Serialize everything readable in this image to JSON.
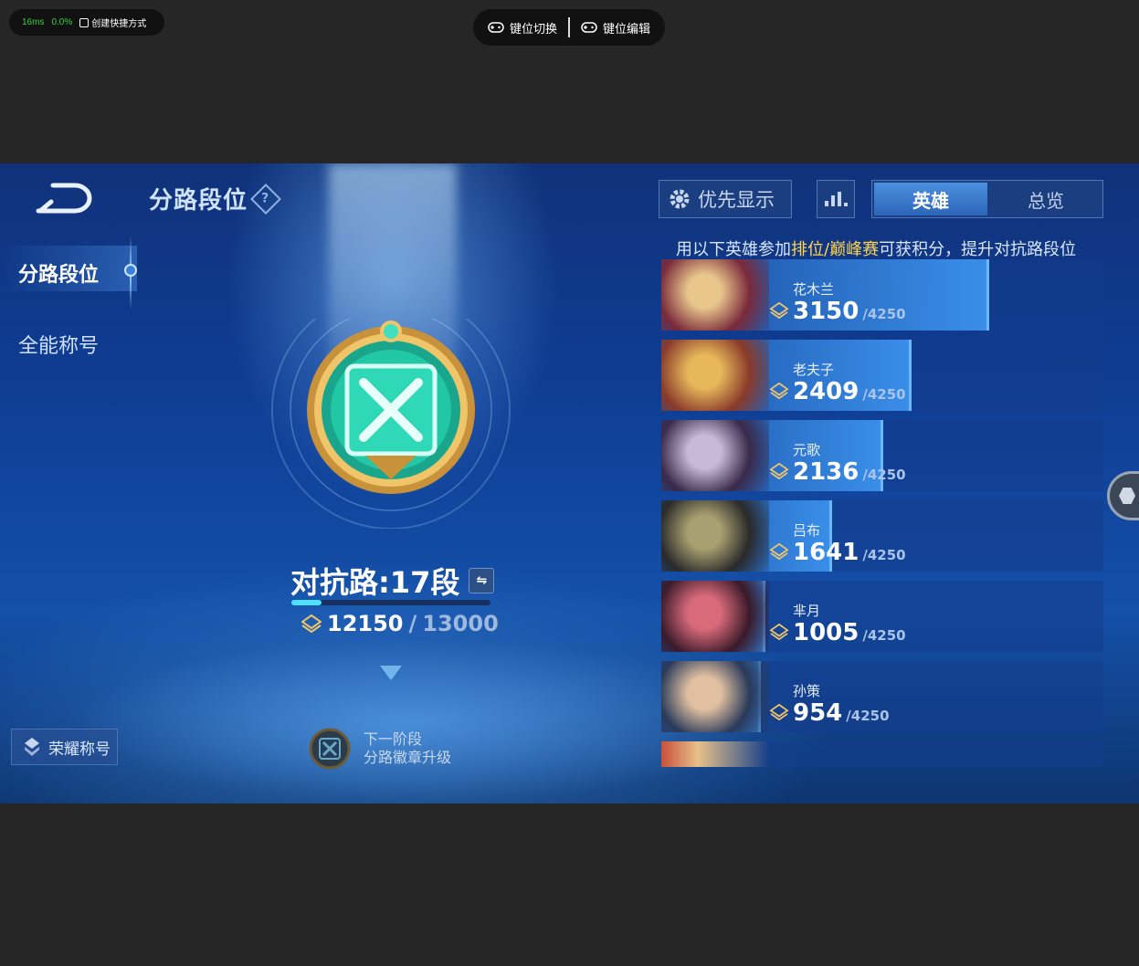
{
  "overlay": {
    "latency": "16ms",
    "loss": "0.0%",
    "shortcut_label": "创建快捷方式",
    "key_switch_label": "键位切换",
    "key_edit_label": "键位编辑"
  },
  "header": {
    "title": "分路段位",
    "help_glyph": "?"
  },
  "sidebar": {
    "items": [
      {
        "label": "分路段位",
        "active": true
      },
      {
        "label": "全能称号",
        "active": false
      }
    ],
    "honor_button": "荣耀称号"
  },
  "rank": {
    "title": "对抗路:17段",
    "swap_glyph": "⇋",
    "current": "12150",
    "separator": "/",
    "max": "13000",
    "progress": 0.15,
    "next_stage_line1": "下一阶段",
    "next_stage_line2": "分路徽章升级"
  },
  "controls": {
    "priority_label": "优先显示",
    "tabs": [
      {
        "label": "英雄",
        "active": true
      },
      {
        "label": "总览",
        "active": false
      }
    ]
  },
  "hint": {
    "prefix": "用以下英雄参加",
    "highlight": "排位/巅峰赛",
    "suffix": "可获积分，提升对抗路段位"
  },
  "heroes": [
    {
      "name": "花木兰",
      "score": "3150",
      "max": "/4250",
      "value": 3150
    },
    {
      "name": "老夫子",
      "score": "2409",
      "max": "/4250",
      "value": 2409
    },
    {
      "name": "元歌",
      "score": "2136",
      "max": "/4250",
      "value": 2136
    },
    {
      "name": "吕布",
      "score": "1641",
      "max": "/4250",
      "value": 1641
    },
    {
      "name": "芈月",
      "score": "1005",
      "max": "/4250",
      "value": 1005
    },
    {
      "name": "孙策",
      "score": "954",
      "max": "/4250",
      "value": 954
    }
  ],
  "hero_max": 4250,
  "colors": {
    "accent": "#4de3ff",
    "highlight": "#ffd44e",
    "bar": "#3a8ee8"
  }
}
